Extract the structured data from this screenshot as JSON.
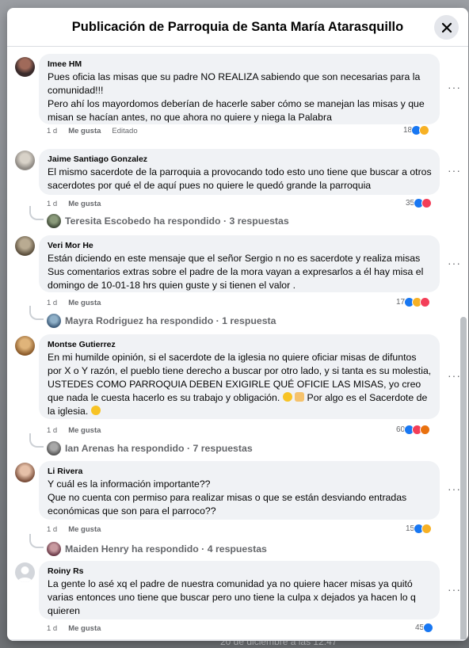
{
  "dialog": {
    "title": "Publicación de Parroquia de Santa María Atarasquillo"
  },
  "background": {
    "caption": "20 de diciembre a las 12:47"
  },
  "comments": [
    {
      "author": "Imee HM",
      "text": "Pues oficia las misas que su padre NO REALIZA sabiendo que son necesarias para la comunidad!!!\nPero ahí los mayordomos deberían de hacerle saber cómo se manejan las misas y que misan se hacían antes, no que ahora no quiere y niega la Palabra",
      "time": "1 d",
      "like_label": "Me gusta",
      "edited": "Editado",
      "reaction_count": "18",
      "reactions": [
        "like",
        "haha"
      ]
    },
    {
      "author": "Jaime Santiago Gonzalez",
      "text": "El mismo sacerdote de la parroquia a provocando todo esto uno tiene que buscar a otros sacerdotes por qué el de aquí pues no quiere le quedó grande la parroquia",
      "time": "1 d",
      "like_label": "Me gusta",
      "reaction_count": "35",
      "reactions": [
        "like",
        "love"
      ],
      "reply_summary": "Teresita Escobedo ha respondido · 3 respuestas"
    },
    {
      "author": "Veri Mor He",
      "text": "Están diciendo en este mensaje que el señor Sergio n no es sacerdote y realiza misas\nSus comentarios extras sobre el padre de la mora vayan a expresarlos a él hay misa el domingo de 10-01-18 hrs quien guste y si tienen el valor .",
      "time": "1 d",
      "like_label": "Me gusta",
      "reaction_count": "17",
      "reactions": [
        "like",
        "haha",
        "love"
      ],
      "reply_summary": "Mayra Rodriguez ha respondido · 1 respuesta"
    },
    {
      "author": "Montse Gutierrez",
      "text_parts": [
        "En mi humilde opinión, si el sacerdote de la iglesia no quiere oficiar misas de difuntos por X o Y razón, el pueblo tiene derecho a buscar por otro lado, y si tanta es su molestia, USTEDES COMO PARROQUIA DEBEN EXIGIRLE QUÉ OFICIE LAS MISAS, yo creo que nada le cuesta hacerlo es su trabajo y obligación. ",
        " Por algo es el Sacerdote de la iglesia. "
      ],
      "time": "1 d",
      "like_label": "Me gusta",
      "reaction_count": "60",
      "reactions": [
        "like",
        "love",
        "angry"
      ],
      "reply_summary": "Ian Arenas ha respondido · 7 respuestas"
    },
    {
      "author": "Li Rivera",
      "text": "Y cuál es la información importante??\nQue no cuenta con permiso para realizar misas o que se están desviando entradas económicas que son para el parroco??",
      "time": "1 d",
      "like_label": "Me gusta",
      "reaction_count": "15",
      "reactions": [
        "like",
        "haha"
      ],
      "reply_summary": "Maiden Henry ha respondido · 4 respuestas"
    },
    {
      "author": "Roiny Rs",
      "text": "La gente lo asé xq el padre de nuestra comunidad ya no quiere hacer misas ya quitó varias entonces uno tiene que buscar pero uno tiene la culpa x dejados ya hacen lo q quieren",
      "time": "1 d",
      "like_label": "Me gusta",
      "reaction_count": "45",
      "reactions": [
        "like"
      ]
    }
  ],
  "more_label": "···",
  "colors": {
    "like": "#1877f2",
    "haha": "#f7b125",
    "love": "#f33e58",
    "angry": "#e9710f",
    "bubble": "#f0f2f5"
  }
}
